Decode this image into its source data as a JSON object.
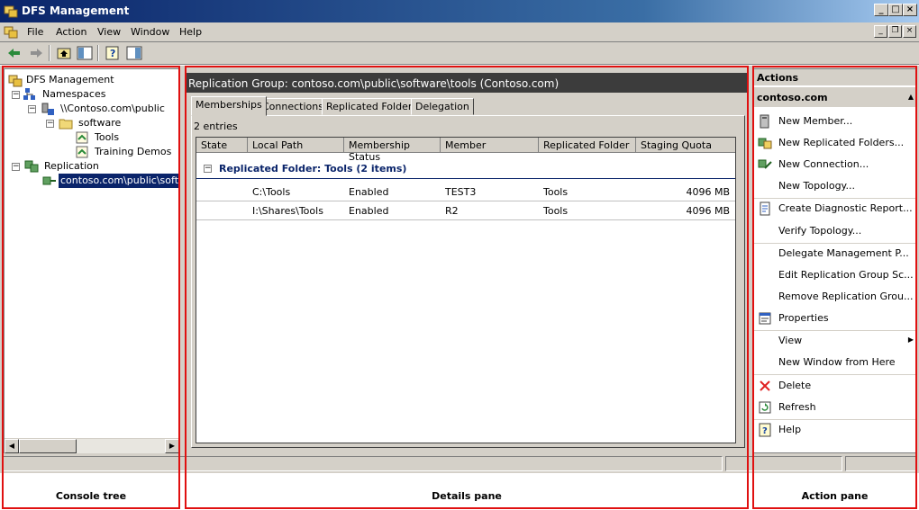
{
  "window": {
    "title": "DFS Management"
  },
  "menu": [
    "File",
    "Action",
    "View",
    "Window",
    "Help"
  ],
  "tree": {
    "root": "DFS Management",
    "namespaces": "Namespaces",
    "namespace_path": "\\\\Contoso.com\\public",
    "folder_software": "software",
    "folder_tools": "Tools",
    "folder_training": "Training Demos",
    "replication": "Replication",
    "replication_group": "contoso.com\\public\\softwa"
  },
  "details": {
    "header": "Replication Group: contoso.com\\public\\software\\tools (Contoso.com)",
    "tabs": [
      "Memberships",
      "Connections",
      "Replicated Folders",
      "Delegation"
    ],
    "entries": "2 entries",
    "columns": [
      "State",
      "Local Path",
      "Membership Status",
      "Member",
      "Replicated Folder",
      "Staging Quota"
    ],
    "group_title": "Replicated Folder: Tools (2 items)",
    "rows": [
      {
        "state": "",
        "local_path": "C:\\Tools",
        "status": "Enabled",
        "member": "TEST3",
        "folder": "Tools",
        "quota": "4096 MB"
      },
      {
        "state": "",
        "local_path": "I:\\Shares\\Tools",
        "status": "Enabled",
        "member": "R2",
        "folder": "Tools",
        "quota": "4096 MB"
      }
    ]
  },
  "actions": {
    "title": "Actions",
    "subtitle": "contoso.com",
    "items": [
      "New Member...",
      "New Replicated Folders...",
      "New Connection...",
      "New Topology...",
      "Create Diagnostic Report...",
      "Verify Topology...",
      "Delegate Management P...",
      "Edit Replication Group Sc...",
      "Remove Replication Grou...",
      "Properties",
      "View",
      "New Window from Here",
      "Delete",
      "Refresh",
      "Help"
    ]
  },
  "captions": {
    "console_tree": "Console tree",
    "details_pane": "Details pane",
    "action_pane": "Action pane"
  },
  "colors": {
    "annotation": "#e01010",
    "selection": "#0a246a",
    "header_dark": "#3c3c3c"
  }
}
